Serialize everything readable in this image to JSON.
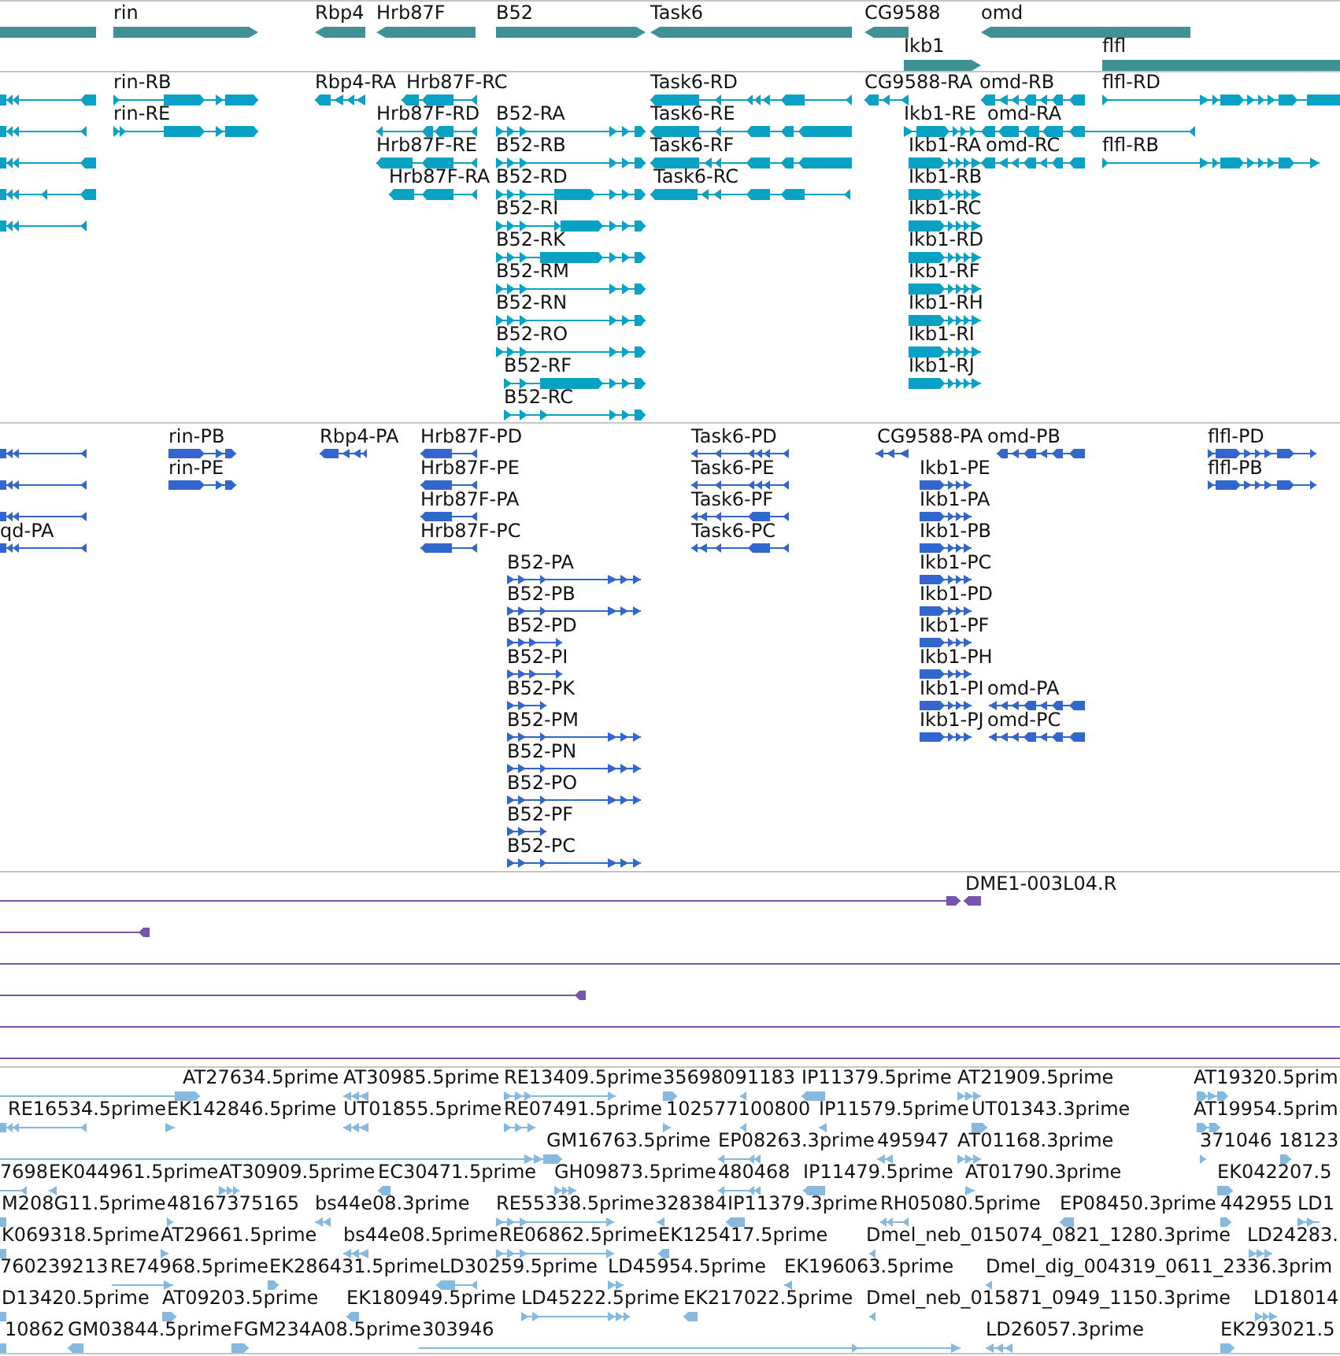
{
  "tracks": [
    {
      "kind": "gene",
      "color": "#3f9196",
      "lanes": [
        {
          "features": [
            {
              "reverse": true
            },
            {
              "label": "rin",
              "reverse": false
            },
            {
              "label": "Rbp4",
              "reverse": true
            },
            {
              "label": "Hrb87F",
              "reverse": true
            },
            {
              "label": "B52",
              "reverse": false
            },
            {
              "label": "Task6",
              "reverse": true
            },
            {
              "label": "CG9588",
              "reverse": true
            },
            {
              "label": "omd",
              "reverse": true
            }
          ]
        },
        {
          "features": [
            {
              "label": "Ikb1",
              "reverse": false
            },
            {
              "label": "flfl",
              "reverse": false
            }
          ]
        }
      ]
    },
    {
      "kind": "transcript",
      "color": "#09a1c4",
      "lanes": [
        {
          "features": [
            {
              "reverse": true
            },
            {
              "label": "rin-RB",
              "reverse": false
            },
            {
              "label": "Rbp4-RA",
              "reverse": true
            },
            {
              "label": "Hrb87F-RC",
              "reverse": true
            },
            {
              "label": "Task6-RD",
              "reverse": true
            },
            {
              "label": "CG9588-RA",
              "reverse": true
            },
            {
              "label": "omd-RB",
              "reverse": true
            },
            {
              "label": "flfl-RD",
              "reverse": false
            }
          ]
        },
        {
          "features": [
            {
              "reverse": true
            },
            {
              "label": "rin-RE",
              "reverse": false
            },
            {
              "label": "Hrb87F-RD",
              "reverse": true
            },
            {
              "label": "B52-RA",
              "reverse": false
            },
            {
              "label": "Task6-RE",
              "reverse": true
            },
            {
              "label": "Ikb1-RE",
              "reverse": false
            },
            {
              "label": "omd-RA",
              "reverse": true
            }
          ]
        },
        {
          "features": [
            {
              "reverse": true
            },
            {
              "label": "Hrb87F-RE",
              "reverse": true
            },
            {
              "label": "B52-RB",
              "reverse": false
            },
            {
              "label": "Task6-RF",
              "reverse": true
            },
            {
              "label": "Ikb1-RA",
              "reverse": false
            },
            {
              "label": "omd-RC",
              "reverse": true
            },
            {
              "label": "flfl-RB",
              "reverse": false
            }
          ]
        },
        {
          "features": [
            {
              "reverse": true
            },
            {
              "label": "Hrb87F-RA",
              "reverse": true
            },
            {
              "label": "B52-RD",
              "reverse": false
            },
            {
              "label": "Task6-RC",
              "reverse": true
            },
            {
              "label": "Ikb1-RB",
              "reverse": false
            }
          ]
        },
        {
          "features": [
            {
              "reverse": true
            },
            {
              "label": "B52-RI",
              "reverse": false
            },
            {
              "label": "Ikb1-RC",
              "reverse": false
            }
          ]
        },
        {
          "features": [
            {
              "label": "B52-RK",
              "reverse": false
            },
            {
              "label": "Ikb1-RD",
              "reverse": false
            }
          ]
        },
        {
          "features": [
            {
              "label": "B52-RM",
              "reverse": false
            },
            {
              "label": "Ikb1-RF",
              "reverse": false
            }
          ]
        },
        {
          "features": [
            {
              "label": "B52-RN",
              "reverse": false
            },
            {
              "label": "Ikb1-RH",
              "reverse": false
            }
          ]
        },
        {
          "features": [
            {
              "label": "B52-RO",
              "reverse": false
            },
            {
              "label": "Ikb1-RI",
              "reverse": false
            }
          ]
        },
        {
          "features": [
            {
              "label": "B52-RF",
              "reverse": false
            },
            {
              "label": "Ikb1-RJ",
              "reverse": false
            }
          ]
        },
        {
          "features": [
            {
              "label": "B52-RC",
              "reverse": false
            }
          ]
        }
      ]
    },
    {
      "kind": "protein",
      "color": "#3366cc",
      "lanes": [
        {
          "features": [
            {
              "reverse": true
            },
            {
              "label": "rin-PB",
              "reverse": false
            },
            {
              "label": "Rbp4-PA",
              "reverse": true
            },
            {
              "label": "Hrb87F-PD",
              "reverse": true
            },
            {
              "label": "Task6-PD",
              "reverse": true
            },
            {
              "label": "CG9588-PA",
              "reverse": true
            },
            {
              "label": "omd-PB",
              "reverse": true
            },
            {
              "label": "flfl-PD",
              "reverse": false
            }
          ]
        },
        {
          "features": [
            {
              "reverse": true
            },
            {
              "label": "rin-PE",
              "reverse": false
            },
            {
              "label": "Hrb87F-PE",
              "reverse": true
            },
            {
              "label": "Task6-PE",
              "reverse": true
            },
            {
              "label": "Ikb1-PE",
              "reverse": false
            },
            {
              "label": "flfl-PB",
              "reverse": false
            }
          ]
        },
        {
          "features": [
            {
              "reverse": true
            },
            {
              "label": "Hrb87F-PA",
              "reverse": true
            },
            {
              "label": "Task6-PF",
              "reverse": true
            },
            {
              "label": "Ikb1-PA",
              "reverse": false
            }
          ]
        },
        {
          "features": [
            {
              "label": "qd-PA",
              "reverse": true
            },
            {
              "label": "Hrb87F-PC",
              "reverse": true
            },
            {
              "label": "Task6-PC",
              "reverse": true
            },
            {
              "label": "Ikb1-PB",
              "reverse": false
            }
          ]
        },
        {
          "features": [
            {
              "label": "B52-PA",
              "reverse": false
            },
            {
              "label": "Ikb1-PC",
              "reverse": false
            }
          ]
        },
        {
          "features": [
            {
              "label": "B52-PB",
              "reverse": false
            },
            {
              "label": "Ikb1-PD",
              "reverse": false
            }
          ]
        },
        {
          "features": [
            {
              "label": "B52-PD",
              "reverse": false
            },
            {
              "label": "Ikb1-PF",
              "reverse": false
            }
          ]
        },
        {
          "features": [
            {
              "label": "B52-PI",
              "reverse": false
            },
            {
              "label": "Ikb1-PH",
              "reverse": false
            }
          ]
        },
        {
          "features": [
            {
              "label": "B52-PK",
              "reverse": false
            },
            {
              "label": "Ikb1-PI",
              "reverse": false
            },
            {
              "label": "omd-PA",
              "reverse": true
            }
          ]
        },
        {
          "features": [
            {
              "label": "B52-PM",
              "reverse": false
            },
            {
              "label": "Ikb1-PJ",
              "reverse": false
            },
            {
              "label": "omd-PC",
              "reverse": true
            }
          ]
        },
        {
          "features": [
            {
              "label": "B52-PN",
              "reverse": false
            }
          ]
        },
        {
          "features": [
            {
              "label": "B52-PO",
              "reverse": false
            }
          ]
        },
        {
          "features": [
            {
              "label": "B52-PF",
              "reverse": false
            }
          ]
        },
        {
          "features": [
            {
              "label": "B52-PC",
              "reverse": false
            }
          ]
        }
      ]
    },
    {
      "kind": "clone",
      "color": "#7755aa",
      "lanes": [
        {
          "features": [
            {
              "kind": "read",
              "reverse": false
            },
            {
              "kind": "read",
              "label": "DME1-003L04.R",
              "reverse": true
            }
          ]
        },
        {
          "features": [
            {
              "kind": "read",
              "reverse": true
            }
          ]
        },
        {
          "features": [
            {
              "kind": "span"
            }
          ]
        },
        {
          "features": [
            {
              "kind": "read",
              "reverse": true
            }
          ]
        },
        {
          "features": [
            {
              "kind": "span"
            }
          ]
        },
        {
          "features": [
            {
              "kind": "span"
            }
          ]
        }
      ]
    },
    {
      "kind": "est",
      "color": "#85b9e0",
      "lanes": [
        {
          "features": [
            {
              "label": "AT27634.5prime",
              "reverse": false
            },
            {
              "label": "AT30985.5prime",
              "reverse": true
            },
            {
              "label": "RE13409.5prime",
              "reverse": false
            },
            {
              "label": "35698091183",
              "reverse": false
            },
            {
              "reverse": true
            },
            {
              "label": "IP11379.5prime",
              "reverse": true
            },
            {
              "label": "AT21909.5prime",
              "reverse": false
            },
            {
              "label": "AT19320.5prim",
              "reverse": false
            }
          ]
        },
        {
          "features": [
            {
              "label": "RE16534.5prime",
              "reverse": true
            },
            {
              "label": "EK142846.5prime",
              "reverse": false
            },
            {
              "label": "UT01855.5prime",
              "reverse": true
            },
            {
              "label": "RE07491.5prime",
              "reverse": false
            },
            {
              "label": "102577100800",
              "reverse": false
            },
            {
              "reverse": true
            },
            {
              "label": "IP11579.5prime",
              "reverse": true
            },
            {
              "label": "UT01343.3prime",
              "reverse": false
            },
            {
              "label": "AT19954.5prim",
              "reverse": false
            }
          ]
        },
        {
          "features": [
            {
              "label": "GM16763.5prime",
              "reverse": false
            },
            {
              "label": "EP08263.3prime",
              "reverse": true
            },
            {
              "label": "495947",
              "reverse": true
            },
            {
              "label": "AT01168.3prime",
              "reverse": false
            },
            {
              "label": "371046",
              "reverse": false
            },
            {
              "label": "18123",
              "reverse": false
            }
          ]
        },
        {
          "features": [
            {
              "label": "7698",
              "reverse": true
            },
            {
              "label": "EK044961.5prime",
              "reverse": true
            },
            {
              "label": "AT30909.5prime",
              "reverse": false
            },
            {
              "label": "EC30471.5prime",
              "reverse": true
            },
            {
              "label": "GH09873.5prime",
              "reverse": false
            },
            {
              "label": "480468",
              "reverse": true
            },
            {
              "label": "IP11479.5prime",
              "reverse": true
            },
            {
              "label": "AT01790.3prime",
              "reverse": false
            },
            {
              "label": "EK042207.5",
              "reverse": false
            }
          ]
        },
        {
          "features": [
            {
              "label": "M208G11.5prime",
              "reverse": true
            },
            {
              "label": "48167375165",
              "reverse": false
            },
            {
              "label": "bs44e08.3prime",
              "reverse": true
            },
            {
              "label": "RE55338.5prime",
              "reverse": false
            },
            {
              "label": "328384",
              "reverse": true
            },
            {
              "label": "IP11379.3prime",
              "reverse": true
            },
            {
              "label": "RH05080.5prime",
              "reverse": true
            },
            {
              "label": "EP08450.3prime",
              "reverse": true
            },
            {
              "label": "442955",
              "reverse": false
            },
            {
              "label": "LD1",
              "reverse": false
            }
          ]
        },
        {
          "features": [
            {
              "label": "K069318.5prime",
              "reverse": true
            },
            {
              "label": "AT29661.5prime",
              "reverse": false
            },
            {
              "label": "bs44e08.5prime",
              "reverse": true
            },
            {
              "label": "RE06862.5prime",
              "reverse": false
            },
            {
              "label": "EK125417.5prime",
              "reverse": true
            },
            {
              "label": "Dmel_neb_015074_0821_1280.3prime",
              "reverse": true
            },
            {
              "label": "LD24283.",
              "reverse": false
            }
          ]
        },
        {
          "features": [
            {
              "label": "760239213"
            },
            {
              "label": "RE74968.5prime",
              "reverse": false
            },
            {
              "label": "EK286431.5prime",
              "reverse": false
            },
            {
              "label": "LD30259.5prime",
              "reverse": true
            },
            {
              "label": "LD45954.5prime",
              "reverse": false
            },
            {
              "label": "EK196063.5prime",
              "reverse": true
            },
            {
              "label": "Dmel_dig_004319_0611_2336.3prim",
              "reverse": true
            }
          ]
        },
        {
          "features": [
            {
              "label": "D13420.5prime",
              "reverse": true
            },
            {
              "label": "AT09203.5prime",
              "reverse": false
            },
            {
              "label": "EK180949.5prime",
              "reverse": true
            },
            {
              "label": "LD45222.5prime",
              "reverse": false
            },
            {
              "label": "EK217022.5prime",
              "reverse": true
            },
            {
              "label": "Dmel_neb_015871_0949_1150.3prime",
              "reverse": true
            },
            {
              "label": "LD18014",
              "reverse": false
            }
          ]
        },
        {
          "features": [
            {
              "label": "10862",
              "reverse": true
            },
            {
              "label": "GM03844.5prime",
              "reverse": true
            },
            {
              "label": "FGM234A08.5prime",
              "reverse": false
            },
            {
              "label": "303946",
              "reverse": false
            },
            {
              "label": "LD26057.3prime",
              "reverse": true
            },
            {
              "label": "EK293021.5",
              "reverse": false
            }
          ]
        }
      ]
    }
  ]
}
